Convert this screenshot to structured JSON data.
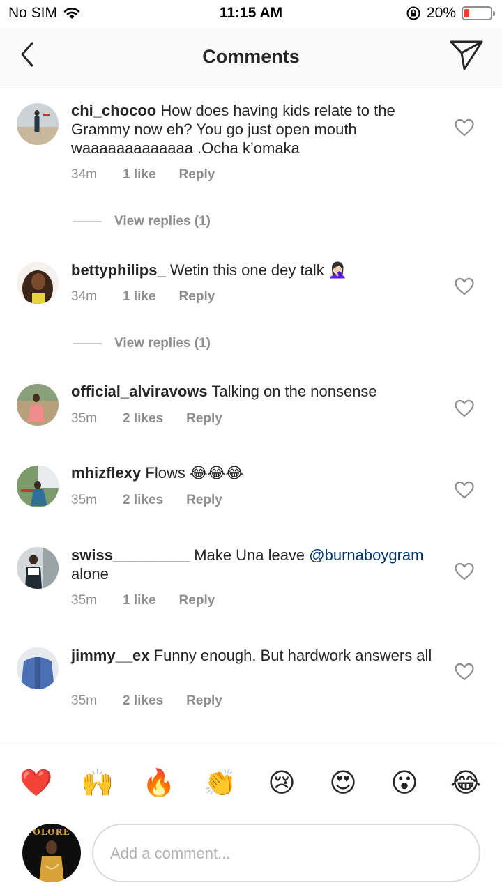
{
  "status_bar": {
    "carrier": "No SIM",
    "time": "11:15 AM",
    "battery": "20%",
    "battery_level": 0.2,
    "battery_color": "#ff3b30"
  },
  "nav": {
    "title": "Comments",
    "back_icon": "chevron-left-icon",
    "send_icon": "paper-plane-icon"
  },
  "comments": [
    {
      "username": "chi_chocoo",
      "text": "How does having kids relate to the Grammy now eh? You go just open mouth waaaaaaaaaaaaa .Ocha k’omaka",
      "age": "34m",
      "likes": "1 like",
      "reply": "Reply",
      "view_replies": "View replies (1)"
    },
    {
      "username": "bettyphilips_",
      "text": "Wetin this one dey talk 🤦🏻‍♀️",
      "age": "34m",
      "likes": "1 like",
      "reply": "Reply",
      "view_replies": "View replies (1)"
    },
    {
      "username": "official_alviravows",
      "text": "Talking on the nonsense",
      "age": "35m",
      "likes": "2 likes",
      "reply": "Reply"
    },
    {
      "username": "mhizflexy",
      "text": "Flows 😂😂😂",
      "age": "35m",
      "likes": "2 likes",
      "reply": "Reply"
    },
    {
      "username": "swiss_________",
      "text_before": "Make Una leave",
      "mention": "@burnaboygram",
      "text_after": "alone",
      "age": "35m",
      "likes": "1 like",
      "reply": "Reply"
    },
    {
      "username": "jimmy__ex",
      "text": "Funny enough. But hardwork answers all",
      "age": "35m",
      "likes": "2 likes",
      "reply": "Reply"
    }
  ],
  "quick_reactions": [
    "❤️",
    "🙌",
    "🔥",
    "👏",
    "😢",
    "😍",
    "😮",
    "😂"
  ],
  "composer": {
    "placeholder": "Add a comment...",
    "avatar_text": "OLORE"
  },
  "colors": {
    "text": "#262626",
    "secondary": "#8e8e8e",
    "mention": "#003569",
    "border": "#dbdbdb"
  }
}
